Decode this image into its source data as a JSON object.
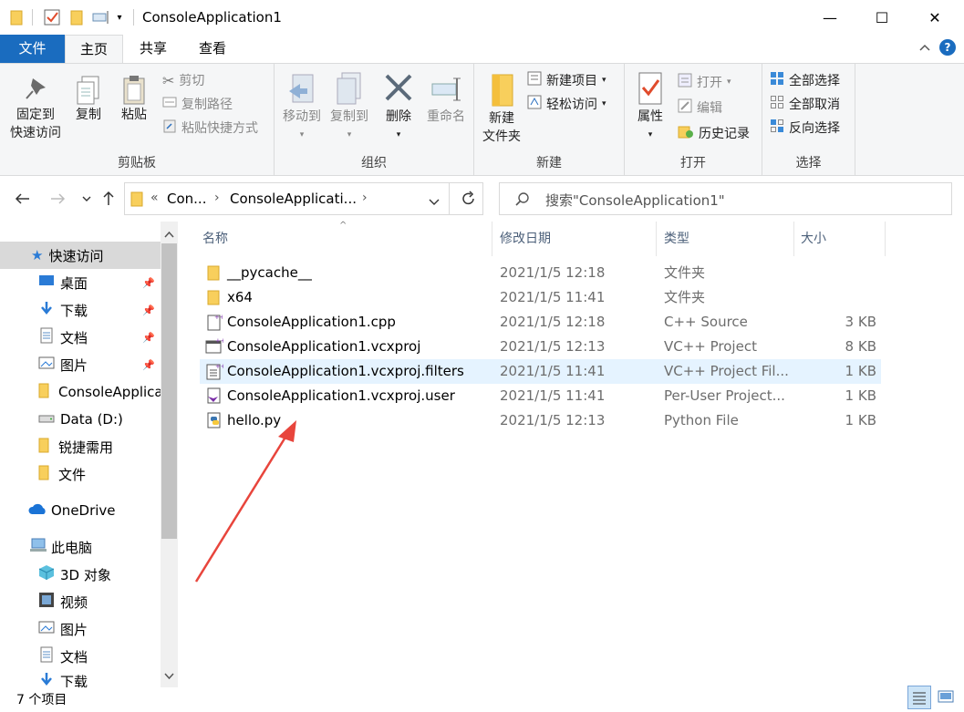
{
  "window": {
    "title": "ConsoleApplication1",
    "minimize_glyph": "—",
    "maximize_glyph": "☐",
    "close_glyph": "✕"
  },
  "tabs": [
    {
      "label": "文件"
    },
    {
      "label": "主页"
    },
    {
      "label": "共享"
    },
    {
      "label": "查看"
    }
  ],
  "ribbon": {
    "clipboard": {
      "group": "剪贴板",
      "pin_label_1": "固定到",
      "pin_label_2": "快速访问",
      "copy": "复制",
      "paste": "粘贴",
      "cut": "剪切",
      "copy_path": "复制路径",
      "paste_shortcut": "粘贴快捷方式"
    },
    "organize": {
      "group": "组织",
      "move_to": "移动到",
      "copy_to": "复制到",
      "delete": "删除",
      "rename": "重命名"
    },
    "new": {
      "group": "新建",
      "new_folder_1": "新建",
      "new_folder_2": "文件夹",
      "new_item": "新建项目",
      "easy_access": "轻松访问"
    },
    "open": {
      "group": "打开",
      "properties": "属性",
      "open": "打开",
      "edit": "编辑",
      "history": "历史记录"
    },
    "select": {
      "group": "选择",
      "select_all": "全部选择",
      "select_none": "全部取消",
      "invert": "反向选择"
    }
  },
  "address": {
    "crumb_prefix": "«",
    "crumb1": "Con...",
    "crumb2": "ConsoleApplicati...",
    "search_placeholder": "搜索\"ConsoleApplication1\""
  },
  "nav_pane": {
    "items": [
      {
        "label": "快速访问",
        "icon": "star-icon"
      },
      {
        "label": "桌面",
        "icon": "desktop-icon",
        "pinned": true
      },
      {
        "label": "下载",
        "icon": "download-icon",
        "pinned": true
      },
      {
        "label": "文档",
        "icon": "document-icon",
        "pinned": true
      },
      {
        "label": "图片",
        "icon": "picture-icon",
        "pinned": true
      },
      {
        "label": "ConsoleApplica",
        "icon": "folder-icon"
      },
      {
        "label": "Data (D:)",
        "icon": "drive-icon"
      },
      {
        "label": "锐捷需用",
        "icon": "folder-icon"
      },
      {
        "label": "文件",
        "icon": "folder-icon"
      },
      {
        "label": "OneDrive",
        "icon": "cloud-icon"
      },
      {
        "label": "此电脑",
        "icon": "computer-icon"
      },
      {
        "label": "3D 对象",
        "icon": "cube-icon"
      },
      {
        "label": "视频",
        "icon": "video-icon"
      },
      {
        "label": "图片",
        "icon": "picture-icon"
      },
      {
        "label": "文档",
        "icon": "document-icon"
      },
      {
        "label": "下载",
        "icon": "download-icon"
      }
    ]
  },
  "columns": {
    "name": "名称",
    "date": "修改日期",
    "type": "类型",
    "size": "大小"
  },
  "files": [
    {
      "name": "__pycache__",
      "date": "2021/1/5 12:18",
      "type": "文件夹",
      "size": "",
      "icon": "folder-icon"
    },
    {
      "name": "x64",
      "date": "2021/1/5 11:41",
      "type": "文件夹",
      "size": "",
      "icon": "folder-icon"
    },
    {
      "name": "ConsoleApplication1.cpp",
      "date": "2021/1/5 12:18",
      "type": "C++ Source",
      "size": "3 KB",
      "icon": "cpp-file-icon"
    },
    {
      "name": "ConsoleApplication1.vcxproj",
      "date": "2021/1/5 12:13",
      "type": "VC++ Project",
      "size": "8 KB",
      "icon": "vcxproj-file-icon"
    },
    {
      "name": "ConsoleApplication1.vcxproj.filters",
      "date": "2021/1/5 11:41",
      "type": "VC++ Project Fil...",
      "size": "1 KB",
      "icon": "filters-file-icon"
    },
    {
      "name": "ConsoleApplication1.vcxproj.user",
      "date": "2021/1/5 11:41",
      "type": "Per-User Project...",
      "size": "1 KB",
      "icon": "vs-user-file-icon"
    },
    {
      "name": "hello.py",
      "date": "2021/1/5 12:13",
      "type": "Python File",
      "size": "1 KB",
      "icon": "python-file-icon"
    }
  ],
  "status": {
    "item_count": "7 个项目"
  },
  "colors": {
    "accent": "#1a6cbf",
    "selected_row": "#e5f3ff",
    "annotation_arrow": "#e8453c",
    "folder": "#f8cf5c"
  }
}
